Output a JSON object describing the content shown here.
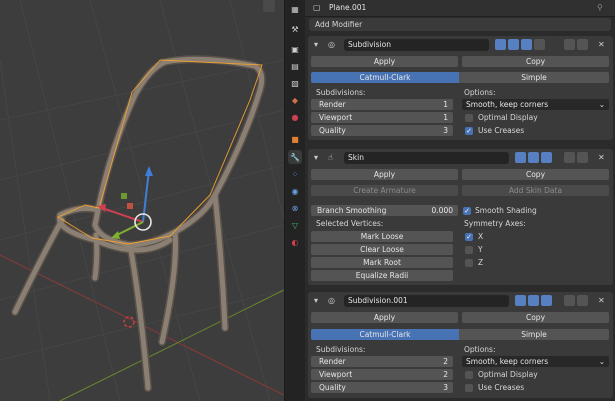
{
  "header": {
    "object_name": "Plane.001"
  },
  "add_modifier": {
    "label": "Add Modifier"
  },
  "modifiers": [
    {
      "name": "Subdivision",
      "apply": "Apply",
      "copy": "Copy",
      "mode_a": "Catmull-Clark",
      "mode_b": "Simple",
      "subdivisions_label": "Subdivisions:",
      "render_label": "Render",
      "render_value": "1",
      "viewport_label": "Viewport",
      "viewport_value": "1",
      "quality_label": "Quality",
      "quality_value": "3",
      "options_label": "Options:",
      "uv_smooth": "Smooth, keep corners",
      "optimal_display": "Optimal Display",
      "optimal_display_checked": false,
      "use_creases": "Use Creases",
      "use_creases_checked": true
    },
    {
      "name": "Skin",
      "apply": "Apply",
      "copy": "Copy",
      "create_armature": "Create Armature",
      "add_skin_data": "Add Skin Data",
      "branch_smoothing_label": "Branch Smoothing",
      "branch_smoothing_value": "0.000",
      "smooth_shading": "Smooth Shading",
      "smooth_shading_checked": true,
      "selected_vertices_label": "Selected Vertices:",
      "mark_loose": "Mark Loose",
      "clear_loose": "Clear Loose",
      "mark_root": "Mark Root",
      "equalize_radii": "Equalize Radii",
      "symmetry_label": "Symmetry Axes:",
      "axis_x": "X",
      "axis_x_checked": true,
      "axis_y": "Y",
      "axis_y_checked": false,
      "axis_z": "Z",
      "axis_z_checked": false
    },
    {
      "name": "Subdivision.001",
      "apply": "Apply",
      "copy": "Copy",
      "mode_a": "Catmull-Clark",
      "mode_b": "Simple",
      "subdivisions_label": "Subdivisions:",
      "render_label": "Render",
      "render_value": "2",
      "viewport_label": "Viewport",
      "viewport_value": "2",
      "quality_label": "Quality",
      "quality_value": "3",
      "options_label": "Options:",
      "uv_smooth": "Smooth, keep corners",
      "optimal_display": "Optimal Display",
      "optimal_display_checked": false,
      "use_creases": "Use Creases",
      "use_creases_checked": false
    }
  ],
  "colors": {
    "accent": "#4772b3",
    "panel": "#3a3a3a",
    "field": "#545454",
    "wire": "#f0a030",
    "tube": "#8a7f72"
  },
  "icons": [
    "editor-type-icon",
    "object-icon",
    "pin-icon",
    "tool-icon",
    "render-icon",
    "output-icon",
    "view-layer-icon",
    "scene-icon",
    "world-icon",
    "object-props-icon",
    "modifier-icon",
    "particles-icon",
    "physics-icon",
    "constraints-icon",
    "data-icon",
    "material-icon"
  ]
}
